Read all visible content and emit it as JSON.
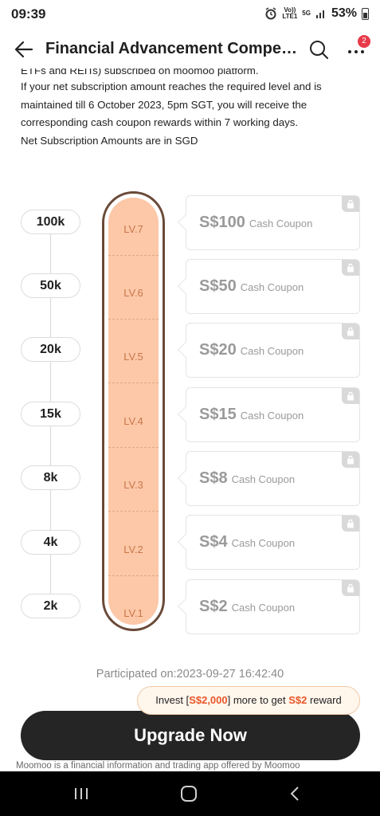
{
  "status_bar": {
    "time": "09:39",
    "network_top": "Vo))",
    "network_bottom": "LTE1",
    "gen": "5G",
    "battery": "53%"
  },
  "header": {
    "title": "Financial Advancement Compet...",
    "notification_count": "2"
  },
  "intro": {
    "cut_line": "ETFs and REITs) subscribed on moomoo platform.",
    "paragraph": "If your net subscription amount reaches the required level and is maintained till 6 October 2023, 5pm SGT, you will receive the corresponding cash coupon rewards within 7 working days.",
    "currency_note": "Net Subscription Amounts are in SGD"
  },
  "levels": [
    {
      "amount": "100k",
      "level": "LV.7",
      "reward": "S$100",
      "reward_label": "Cash Coupon",
      "locked": true
    },
    {
      "amount": "50k",
      "level": "LV.6",
      "reward": "S$50",
      "reward_label": "Cash Coupon",
      "locked": true
    },
    {
      "amount": "20k",
      "level": "LV.5",
      "reward": "S$20",
      "reward_label": "Cash Coupon",
      "locked": true
    },
    {
      "amount": "15k",
      "level": "LV.4",
      "reward": "S$15",
      "reward_label": "Cash Coupon",
      "locked": true
    },
    {
      "amount": "8k",
      "level": "LV.3",
      "reward": "S$8",
      "reward_label": "Cash Coupon",
      "locked": true
    },
    {
      "amount": "4k",
      "level": "LV.2",
      "reward": "S$4",
      "reward_label": "Cash Coupon",
      "locked": true
    },
    {
      "amount": "2k",
      "level": "LV.1",
      "reward": "S$2",
      "reward_label": "Cash Coupon",
      "locked": true
    }
  ],
  "participated": "Participated on:2023-09-27 16:42:40",
  "tip": {
    "prefix": "Invest [",
    "amount": "S$2,000",
    "middle": "] more to get ",
    "reward": "S$2",
    "suffix": " reward"
  },
  "upgrade_button": "Upgrade Now",
  "disclaimer": "Moomoo is a financial information and trading app offered by Moomoo",
  "colors": {
    "tube_fill": "#fcc8a8",
    "tube_border": "#6a4a39",
    "highlight": "#e8572a",
    "button": "#252525",
    "badge": "#e83a4a"
  }
}
